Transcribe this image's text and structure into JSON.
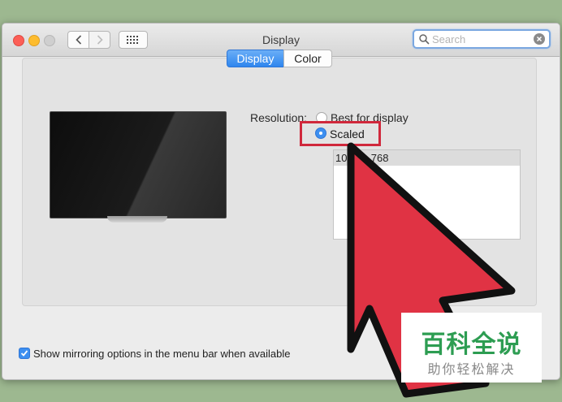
{
  "window": {
    "title": "Display",
    "search": {
      "placeholder": "Search",
      "value": ""
    }
  },
  "tabs": [
    {
      "label": "Display",
      "selected": true
    },
    {
      "label": "Color",
      "selected": false
    }
  ],
  "resolution": {
    "label": "Resolution:",
    "options": [
      {
        "label": "Best for display",
        "selected": false
      },
      {
        "label": "Scaled",
        "selected": true
      }
    ],
    "list_items": [
      "1024 × 768"
    ]
  },
  "mirroring": {
    "label": "Show mirroring options in the menu bar when available",
    "checked": true
  },
  "watermark": {
    "main": "百科全说",
    "sub": "助你轻松解决"
  },
  "colors": {
    "accent": "#3d8ff0",
    "highlight_box": "#d0283c",
    "arrow": "#e03344",
    "watermark_green": "#2d9d52"
  }
}
